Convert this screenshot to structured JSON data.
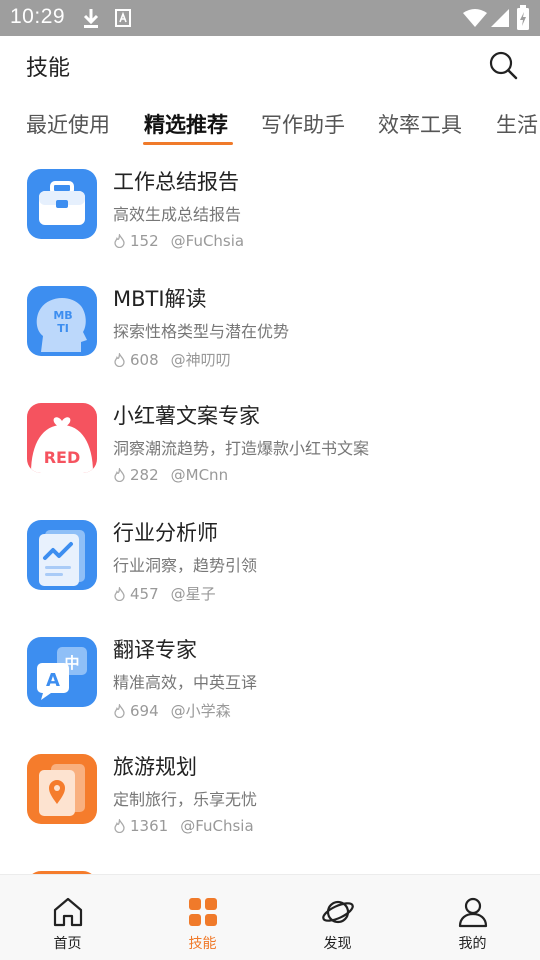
{
  "status_bar": {
    "time": "10:29"
  },
  "header": {
    "title": "技能"
  },
  "tabs": [
    {
      "label": "最近使用",
      "active": false
    },
    {
      "label": "精选推荐",
      "active": true
    },
    {
      "label": "写作助手",
      "active": false
    },
    {
      "label": "效率工具",
      "active": false
    },
    {
      "label": "生活",
      "active": false
    }
  ],
  "skills": [
    {
      "name": "工作总结报告",
      "desc": "高效生成总结报告",
      "heat": "152",
      "author": "@FuChsia",
      "icon": "briefcase-icon"
    },
    {
      "name": "MBTI解读",
      "desc": "探索性格类型与潜在优势",
      "heat": "608",
      "author": "@神叨叨",
      "icon": "mbti-head-icon",
      "icon_text": "MB TI"
    },
    {
      "name": "小红薯文案专家",
      "desc": "洞察潮流趋势，打造爆款小红书文案",
      "heat": "282",
      "author": "@MCnn",
      "icon": "red-bag-icon",
      "icon_text": "RED"
    },
    {
      "name": "行业分析师",
      "desc": "行业洞察，趋势引领",
      "heat": "457",
      "author": "@星子",
      "icon": "trend-document-icon"
    },
    {
      "name": "翻译专家",
      "desc": "精准高效，中英互译",
      "heat": "694",
      "author": "@小学森",
      "icon": "translate-icon",
      "icon_text_a": "A",
      "icon_text_b": "中"
    },
    {
      "name": "旅游规划",
      "desc": "定制旅行，乐享无忧",
      "heat": "1361",
      "author": "@FuChsia",
      "icon": "travel-map-icon"
    }
  ],
  "bottom_nav": [
    {
      "label": "首页",
      "icon": "home-icon",
      "active": false
    },
    {
      "label": "技能",
      "icon": "skills-grid-icon",
      "active": true
    },
    {
      "label": "发现",
      "icon": "planet-icon",
      "active": false
    },
    {
      "label": "我的",
      "icon": "user-icon",
      "active": false
    }
  ],
  "colors": {
    "accent": "#f07a2a",
    "status_bar": "#9e9e9e",
    "blue_icon": "#3d8ef0",
    "red_icon": "#f5535f",
    "orange_icon": "#f57c2c"
  }
}
